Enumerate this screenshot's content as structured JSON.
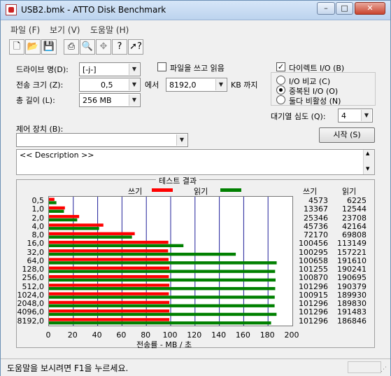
{
  "window": {
    "title": "USB2.bmk - ATTO Disk Benchmark"
  },
  "caption_buttons": {
    "minimize": "–",
    "maximize": "□",
    "close": "✕"
  },
  "menu": [
    "파일 (F)",
    "보기 (V)",
    "도움말 (H)"
  ],
  "toolbar_icons": [
    "new-icon",
    "open-icon",
    "save-icon",
    "print-icon",
    "print-preview-icon",
    "move-icon",
    "help-icon",
    "context-help-icon"
  ],
  "form": {
    "drive_label": "드라이브 명(D):",
    "drive_value": "[-j-]",
    "transfer_label": "전송 크기 (Z):",
    "transfer_from": "0,5",
    "transfer_mid": "에서",
    "transfer_to": "8192,0",
    "transfer_unit": "KB 까지",
    "total_label": "총 길이 (L):",
    "total_value": "256 MB",
    "rw_checkbox": "파일을 쓰고 읽음",
    "direct_io": "다이렉트 I/O (B)",
    "io_compare": "I/O 비교 (C)",
    "overlapped_io": "중복된 I/O (O)",
    "neither": "둘다 비활성 (N)",
    "queue_label": "대기열 심도 (Q):",
    "queue_value": "4",
    "control_label": "제어 장치 (B):",
    "control_value": "",
    "start_button": "시작 (S)",
    "description": "<< Description >>"
  },
  "results": {
    "title": "테스트 결과",
    "legend_write": "쓰기",
    "legend_read": "읽기",
    "col_write": "쓰기",
    "col_read": "읽기",
    "write_color": "#ff0000",
    "read_color": "#008000"
  },
  "chart_data": {
    "type": "bar",
    "orientation": "horizontal",
    "xlabel": "전송률 - MB / 초",
    "xlim": [
      0,
      200
    ],
    "xticks": [
      0,
      20,
      40,
      60,
      80,
      100,
      120,
      140,
      160,
      180,
      200
    ],
    "grid": true,
    "categories": [
      "0,5",
      "1,0",
      "2,0",
      "4,0",
      "8,0",
      "16,0",
      "32,0",
      "64,0",
      "128,0",
      "256,0",
      "512,0",
      "1024,0",
      "2048,0",
      "4096,0",
      "8192,0"
    ],
    "series": [
      {
        "name": "쓰기",
        "color": "#ff0000",
        "values": [
          4.5,
          13.1,
          24.8,
          44.7,
          70.5,
          98.1,
          97.9,
          98.3,
          98.9,
          98.5,
          98.9,
          98.5,
          98.9,
          98.9,
          98.9
        ]
      },
      {
        "name": "읽기",
        "color": "#008000",
        "values": [
          6.1,
          12.3,
          23.2,
          41.2,
          68.2,
          110.5,
          153.5,
          187.1,
          185.8,
          186.2,
          185.9,
          185.5,
          185.4,
          187.0,
          182.5
        ]
      }
    ],
    "write_kb": [
      "4573",
      "13367",
      "25346",
      "45736",
      "72170",
      "100456",
      "100295",
      "100658",
      "101255",
      "100870",
      "101296",
      "100915",
      "101296",
      "101296",
      "101296"
    ],
    "read_kb": [
      "6225",
      "12544",
      "23708",
      "42164",
      "69808",
      "113149",
      "157221",
      "191610",
      "190241",
      "190695",
      "190379",
      "189930",
      "189830",
      "191483",
      "186846"
    ]
  },
  "status": {
    "text": "도움말을 보시려면 F1을 누르세요."
  }
}
